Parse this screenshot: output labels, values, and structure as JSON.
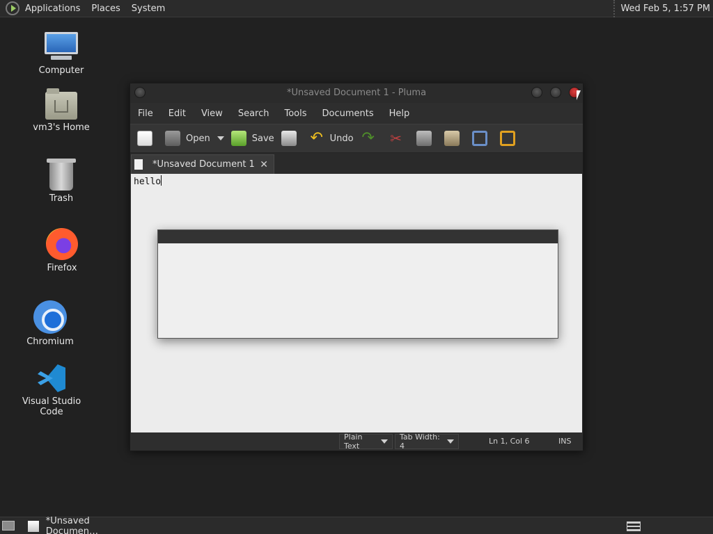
{
  "top_panel": {
    "menus": [
      "Applications",
      "Places",
      "System"
    ],
    "clock": "Wed Feb  5, 1:57 PM"
  },
  "desktop": {
    "icons": [
      {
        "label": "Computer",
        "icon": "computer-icon"
      },
      {
        "label": "vm3's Home",
        "icon": "home-folder-icon"
      },
      {
        "label": "Trash",
        "icon": "trash-icon"
      },
      {
        "label": "Firefox",
        "icon": "firefox-icon"
      },
      {
        "label": "Chromium",
        "icon": "chromium-icon"
      },
      {
        "label": "Visual Studio Code",
        "icon": "vscode-icon"
      }
    ]
  },
  "window": {
    "title": "*Unsaved Document 1 - Pluma",
    "menu": [
      "File",
      "Edit",
      "View",
      "Search",
      "Tools",
      "Documents",
      "Help"
    ],
    "toolbar": {
      "open_label": "Open",
      "save_label": "Save",
      "undo_label": "Undo"
    },
    "tab": {
      "label": "*Unsaved Document 1",
      "close": "✕"
    },
    "editor_text": "hello",
    "statusbar": {
      "language": "Plain Text",
      "tab_width": "Tab Width:  4",
      "position": "Ln 1, Col 6",
      "mode": "INS"
    }
  },
  "bottom_panel": {
    "task_label": "*Unsaved Documen…"
  }
}
